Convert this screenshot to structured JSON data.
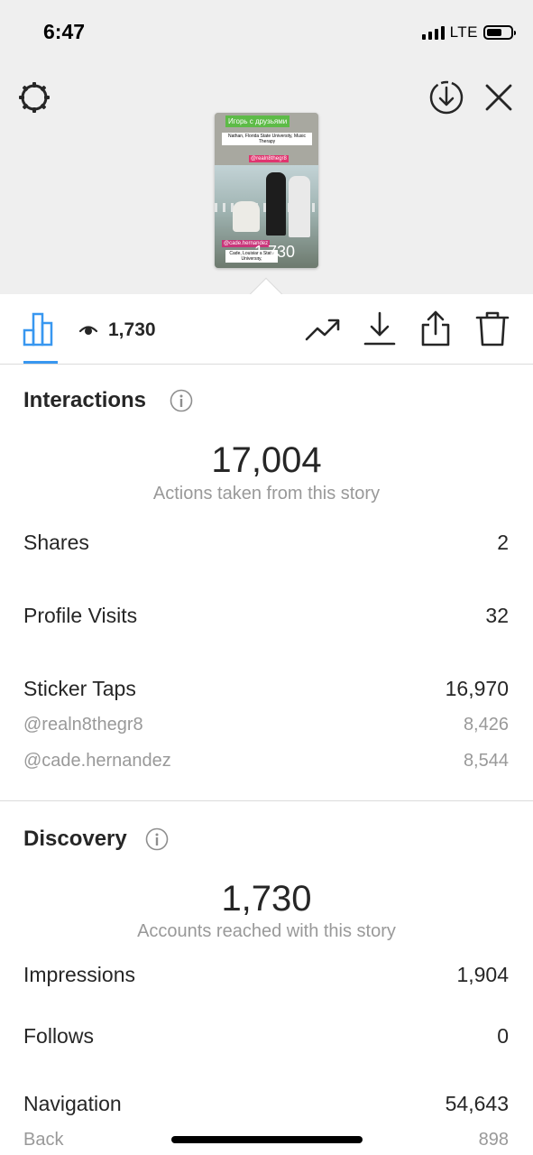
{
  "status_bar": {
    "time": "6:47",
    "network": "LTE"
  },
  "story_preview": {
    "title_sticker": "Игорь с друзьями",
    "caption_top": "Nathan, Florida State University, Music Therapy",
    "mention_top": "@realn8thegr8",
    "mention_bottom": "@cade.hernandez",
    "caption_bottom": "Cade, Louisiana State University,",
    "views_overlay": "1,730"
  },
  "toolbar": {
    "view_count": "1,730",
    "icons": [
      "insights-icon",
      "eye-icon",
      "trending-icon",
      "download-icon",
      "share-icon",
      "trash-icon"
    ]
  },
  "interactions": {
    "title": "Interactions",
    "total": "17,004",
    "caption": "Actions taken from this story",
    "rows": [
      {
        "label": "Shares",
        "value": "2"
      },
      {
        "label": "Profile Visits",
        "value": "32"
      },
      {
        "label": "Sticker Taps",
        "value": "16,970"
      }
    ],
    "sticker_breakdown": [
      {
        "label": "@realn8thegr8",
        "value": "8,426"
      },
      {
        "label": "@cade.hernandez",
        "value": "8,544"
      }
    ]
  },
  "discovery": {
    "title": "Discovery",
    "total": "1,730",
    "caption": "Accounts reached with this story",
    "rows": [
      {
        "label": "Impressions",
        "value": "1,904"
      },
      {
        "label": "Follows",
        "value": "0"
      },
      {
        "label": "Navigation",
        "value": "54,643"
      }
    ],
    "navigation_breakdown": [
      {
        "label": "Back",
        "value": "898"
      }
    ]
  },
  "colors": {
    "accent": "#3897f0",
    "muted": "#999999",
    "text": "#262626",
    "top_bg": "#efefef"
  }
}
